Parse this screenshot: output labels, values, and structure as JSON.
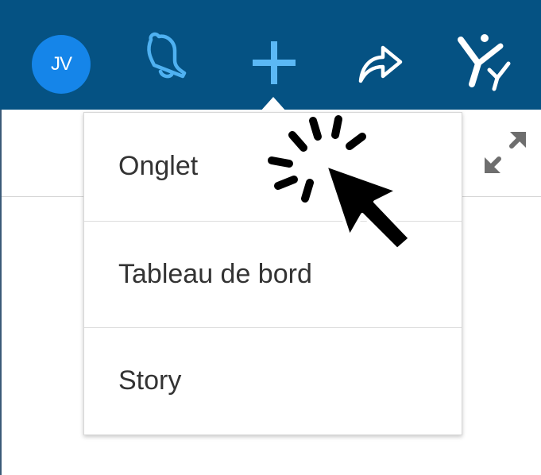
{
  "header": {
    "avatar_initials": "JV",
    "bar_color": "#055283",
    "avatar_color": "#1585e9",
    "icons": [
      "avatar",
      "bell-icon",
      "plus-icon",
      "share-icon",
      "person-y-icon"
    ]
  },
  "menu": {
    "items": [
      {
        "label": "Onglet"
      },
      {
        "label": "Tableau de bord"
      },
      {
        "label": "Story"
      }
    ]
  },
  "content": {
    "icons": [
      "expand-icon",
      "click-cursor-icon"
    ]
  }
}
